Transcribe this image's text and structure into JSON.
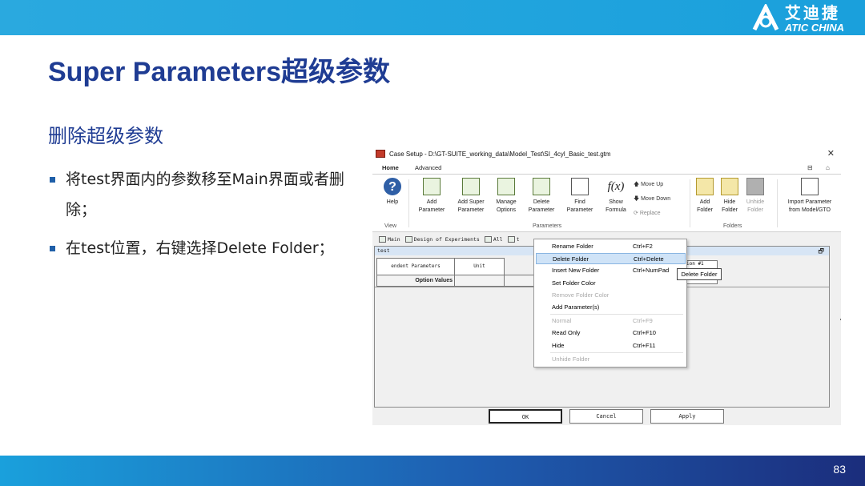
{
  "brand": {
    "name_cn": "艾迪捷",
    "name_en": "ATIC CHINA",
    "logo_icon": "atic-logo-icon"
  },
  "slide": {
    "title": "Super Parameters超级参数",
    "subtitle": "删除超级参数",
    "bullets": [
      "将test界面内的参数移至Main界面或者删除；",
      "在test位置，右键选择Delete Folder；"
    ],
    "page_number": "83",
    "colors": {
      "title": "#1f3c93",
      "top_bar": "#2aa9df",
      "bottom_bar_end": "#1b2d7c"
    }
  },
  "app": {
    "window_title": "Case Setup - D:\\GT-SUITE_working_data\\Model_Test\\SI_4cyl_Basic_test.gtm",
    "close_glyph": "✕",
    "tabs": [
      "Home",
      "Advanced"
    ],
    "tab_controls": {
      "restore": "⊟",
      "collapse": "⌂"
    },
    "ribbon": {
      "help": {
        "label": "Help",
        "icon": "help-icon"
      },
      "view_group_label": "View",
      "parameters": [
        {
          "line1": "Add",
          "line2": "Parameter",
          "icon": "add-parameter-icon"
        },
        {
          "line1": "Add Super",
          "line2": "Parameter",
          "icon": "add-super-parameter-icon"
        },
        {
          "line1": "Manage",
          "line2": "Options",
          "icon": "manage-options-icon"
        },
        {
          "line1": "Delete",
          "line2": "Parameter",
          "icon": "delete-parameter-icon"
        },
        {
          "line1": "Find",
          "line2": "Parameter",
          "icon": "find-parameter-icon"
        },
        {
          "line1": "Show",
          "line2": "Formula",
          "icon": "fx-icon"
        }
      ],
      "move_up": "Move Up",
      "move_down": "Move Down",
      "replace": "Replace",
      "parameters_group_label": "Parameters",
      "folders": [
        {
          "line1": "Add",
          "line2": "Folder",
          "icon": "add-folder-icon",
          "enabled": true
        },
        {
          "line1": "Hide",
          "line2": "Folder",
          "icon": "hide-folder-icon",
          "enabled": true
        },
        {
          "line1": "Unhide",
          "line2": "Folder",
          "icon": "unhide-folder-icon",
          "enabled": false
        }
      ],
      "folders_group_label": "Folders",
      "import": {
        "line1": "Import Parameter",
        "line2": "from Model/GTO",
        "icon": "import-icon"
      }
    },
    "folder_tabs": [
      "Main",
      "Design of Experiments",
      "All",
      "t"
    ],
    "panel": {
      "name": "test",
      "restore_glyph": "🗗",
      "col_headers": [
        "endent Parameters",
        "Unit"
      ],
      "row_label": "Option Values",
      "collapse_glyph": "<<"
    },
    "buttons": {
      "ok": "OK",
      "cancel": "Cancel",
      "apply": "Apply"
    },
    "peek_text": "ion #1"
  },
  "context_menu": {
    "items": [
      {
        "label": "Rename Folder",
        "shortcut": "Ctrl+F2",
        "enabled": true
      },
      {
        "label": "Delete Folder",
        "shortcut": "Ctrl+Delete",
        "enabled": true,
        "highlighted": true
      },
      {
        "label": "Insert New Folder",
        "shortcut": "Ctrl+NumPad",
        "enabled": true
      },
      {
        "label": "Set Folder Color",
        "shortcut": "",
        "enabled": true
      },
      {
        "label": "Remove Folder Color",
        "shortcut": "",
        "enabled": false
      },
      {
        "label": "Add Parameter(s)",
        "shortcut": "",
        "enabled": true
      },
      {
        "label": "Normal",
        "shortcut": "Ctrl+F9",
        "enabled": false
      },
      {
        "label": "Read Only",
        "shortcut": "Ctrl+F10",
        "enabled": true
      },
      {
        "label": "Hide",
        "shortcut": "Ctrl+F11",
        "enabled": true
      },
      {
        "label": "Unhide Folder",
        "shortcut": "",
        "enabled": false
      }
    ],
    "tooltip": "Delete Folder"
  }
}
